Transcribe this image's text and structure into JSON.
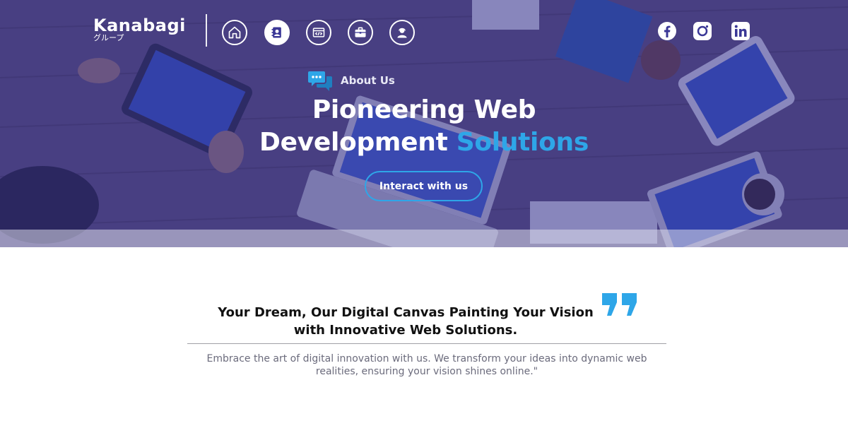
{
  "brand": {
    "name": "Kanabagi",
    "subtitle": "グループ"
  },
  "nav": {
    "items": [
      {
        "icon": "home-icon",
        "active": false
      },
      {
        "icon": "contact-book-icon",
        "active": true
      },
      {
        "icon": "code-window-icon",
        "active": false
      },
      {
        "icon": "briefcase-icon",
        "active": false
      },
      {
        "icon": "user-support-icon",
        "active": false
      }
    ]
  },
  "social": [
    {
      "icon": "facebook-icon"
    },
    {
      "icon": "instagram-icon"
    },
    {
      "icon": "linkedin-icon"
    }
  ],
  "hero": {
    "eyebrow_icon": "chat-bubbles-icon",
    "eyebrow": "About Us",
    "title_line1": "Pioneering Web",
    "title_line2_plain": "Development",
    "title_line2_accent": "Solutions",
    "cta_label": "Interact with us"
  },
  "quote": {
    "title": "Your Dream, Our Digital Canvas Painting Your Vision with Innovative Web Solutions.",
    "body": "Embrace the art of digital innovation with us. We transform your ideas into dynamic web realities, ensuring your vision shines online.\""
  },
  "colors": {
    "hero_overlay": "#3a3796",
    "accent": "#2ea6e8",
    "text_dark": "#111111",
    "text_muted": "#6b6b7c"
  }
}
